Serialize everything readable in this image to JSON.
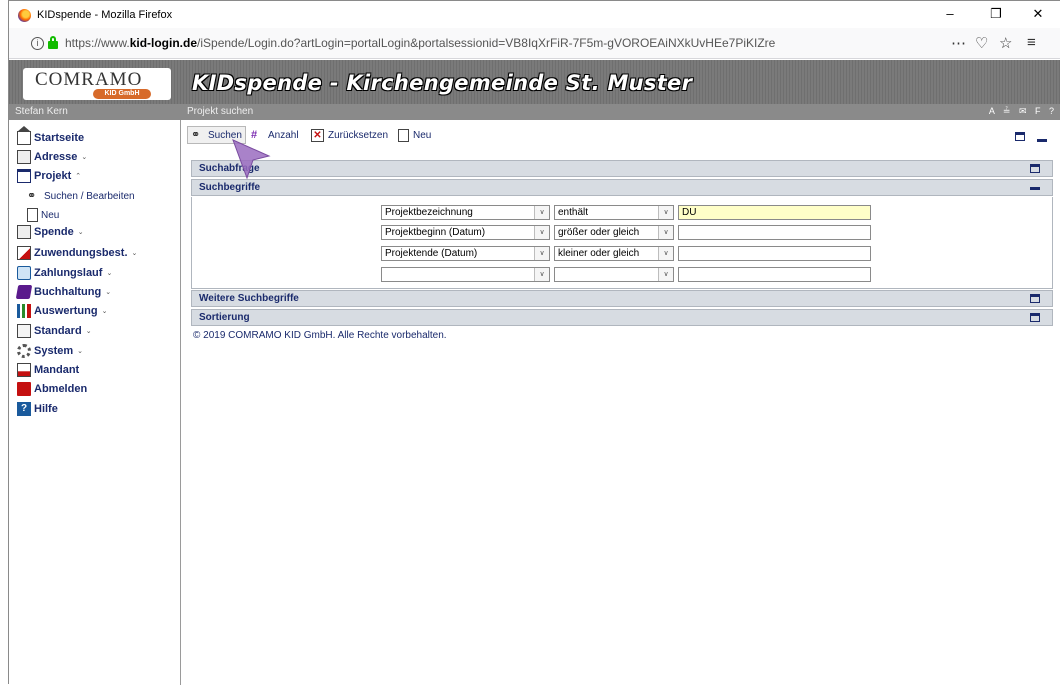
{
  "browser": {
    "window_title": "KIDspende - Mozilla Firefox",
    "url_prefix": "https://www.",
    "url_domain": "kid-login.de",
    "url_path": "/iSpende/Login.do?artLogin=portalLogin&portalsessionid=VB8IqXrFiR-7F5m-gVOROEAiNXkUvHEe7PiKIZre",
    "controls": {
      "minimize": "–",
      "restore": "❐",
      "close": "✕"
    },
    "toolbar_icons": {
      "more": "⋯",
      "pocket": "♡",
      "bookmark": "☆",
      "menu": "≡"
    }
  },
  "app": {
    "logo_text": "COMRAMO",
    "logo_sub": "KID GmbH",
    "title": "KIDspende - Kirchengemeinde St. Muster",
    "user": "Stefan Kern",
    "page": "Projekt suchen",
    "strip_icons": "A ≟ ✉ F ?"
  },
  "sidebar": {
    "items": [
      {
        "label": "Startseite",
        "icon": "house-icon"
      },
      {
        "label": "Adresse",
        "icon": "address-card-icon",
        "caret": "⌄"
      },
      {
        "label": "Projekt",
        "icon": "project-icon",
        "caret": "⌃"
      },
      {
        "label": "Suchen / Bearbeiten",
        "icon": "binoculars-icon"
      },
      {
        "label": "Neu",
        "icon": "new-page-icon"
      },
      {
        "label": "Spende",
        "icon": "donation-icon",
        "caret": "⌄"
      },
      {
        "label": "Zuwendungsbest.",
        "icon": "receipt-icon",
        "caret": "⌄"
      },
      {
        "label": "Zahlungslauf",
        "icon": "payment-run-icon",
        "caret": "⌄"
      },
      {
        "label": "Buchhaltung",
        "icon": "accounting-book-icon",
        "caret": "⌄"
      },
      {
        "label": "Auswertung",
        "icon": "bar-chart-icon",
        "caret": "⌄"
      },
      {
        "label": "Standard",
        "icon": "standard-icon",
        "caret": "⌄"
      },
      {
        "label": "System",
        "icon": "gear-icon",
        "caret": "⌄"
      },
      {
        "label": "Mandant",
        "icon": "client-icon"
      },
      {
        "label": "Abmelden",
        "icon": "logout-icon"
      },
      {
        "label": "Hilfe",
        "icon": "help-icon",
        "glyph": "?"
      }
    ]
  },
  "toolbar": {
    "search": "Suchen",
    "count": "Anzahl",
    "reset": "Zurücksetzen",
    "new": "Neu"
  },
  "panels": {
    "query": "Suchabfrage",
    "criteria": "Suchbegriffe",
    "more": "Weitere Suchbegriffe",
    "sort": "Sortierung"
  },
  "criteria_rows": [
    {
      "field": "Projektbezeichnung",
      "operator": "enthält",
      "value": "DU"
    },
    {
      "field": "Projektbeginn (Datum)",
      "operator": "größer oder gleich",
      "value": ""
    },
    {
      "field": "Projektende (Datum)",
      "operator": "kleiner oder gleich",
      "value": ""
    },
    {
      "field": "",
      "operator": "",
      "value": ""
    }
  ],
  "footer": "© 2019 COMRAMO KID GmbH. Alle Rechte vorbehalten.",
  "colors": {
    "accent": "#1a2a6c",
    "header_bg": "#777777",
    "panel_head": "#d7dce2",
    "highlight_input": "#ffffc8",
    "cursor": "#9a6cc0"
  }
}
